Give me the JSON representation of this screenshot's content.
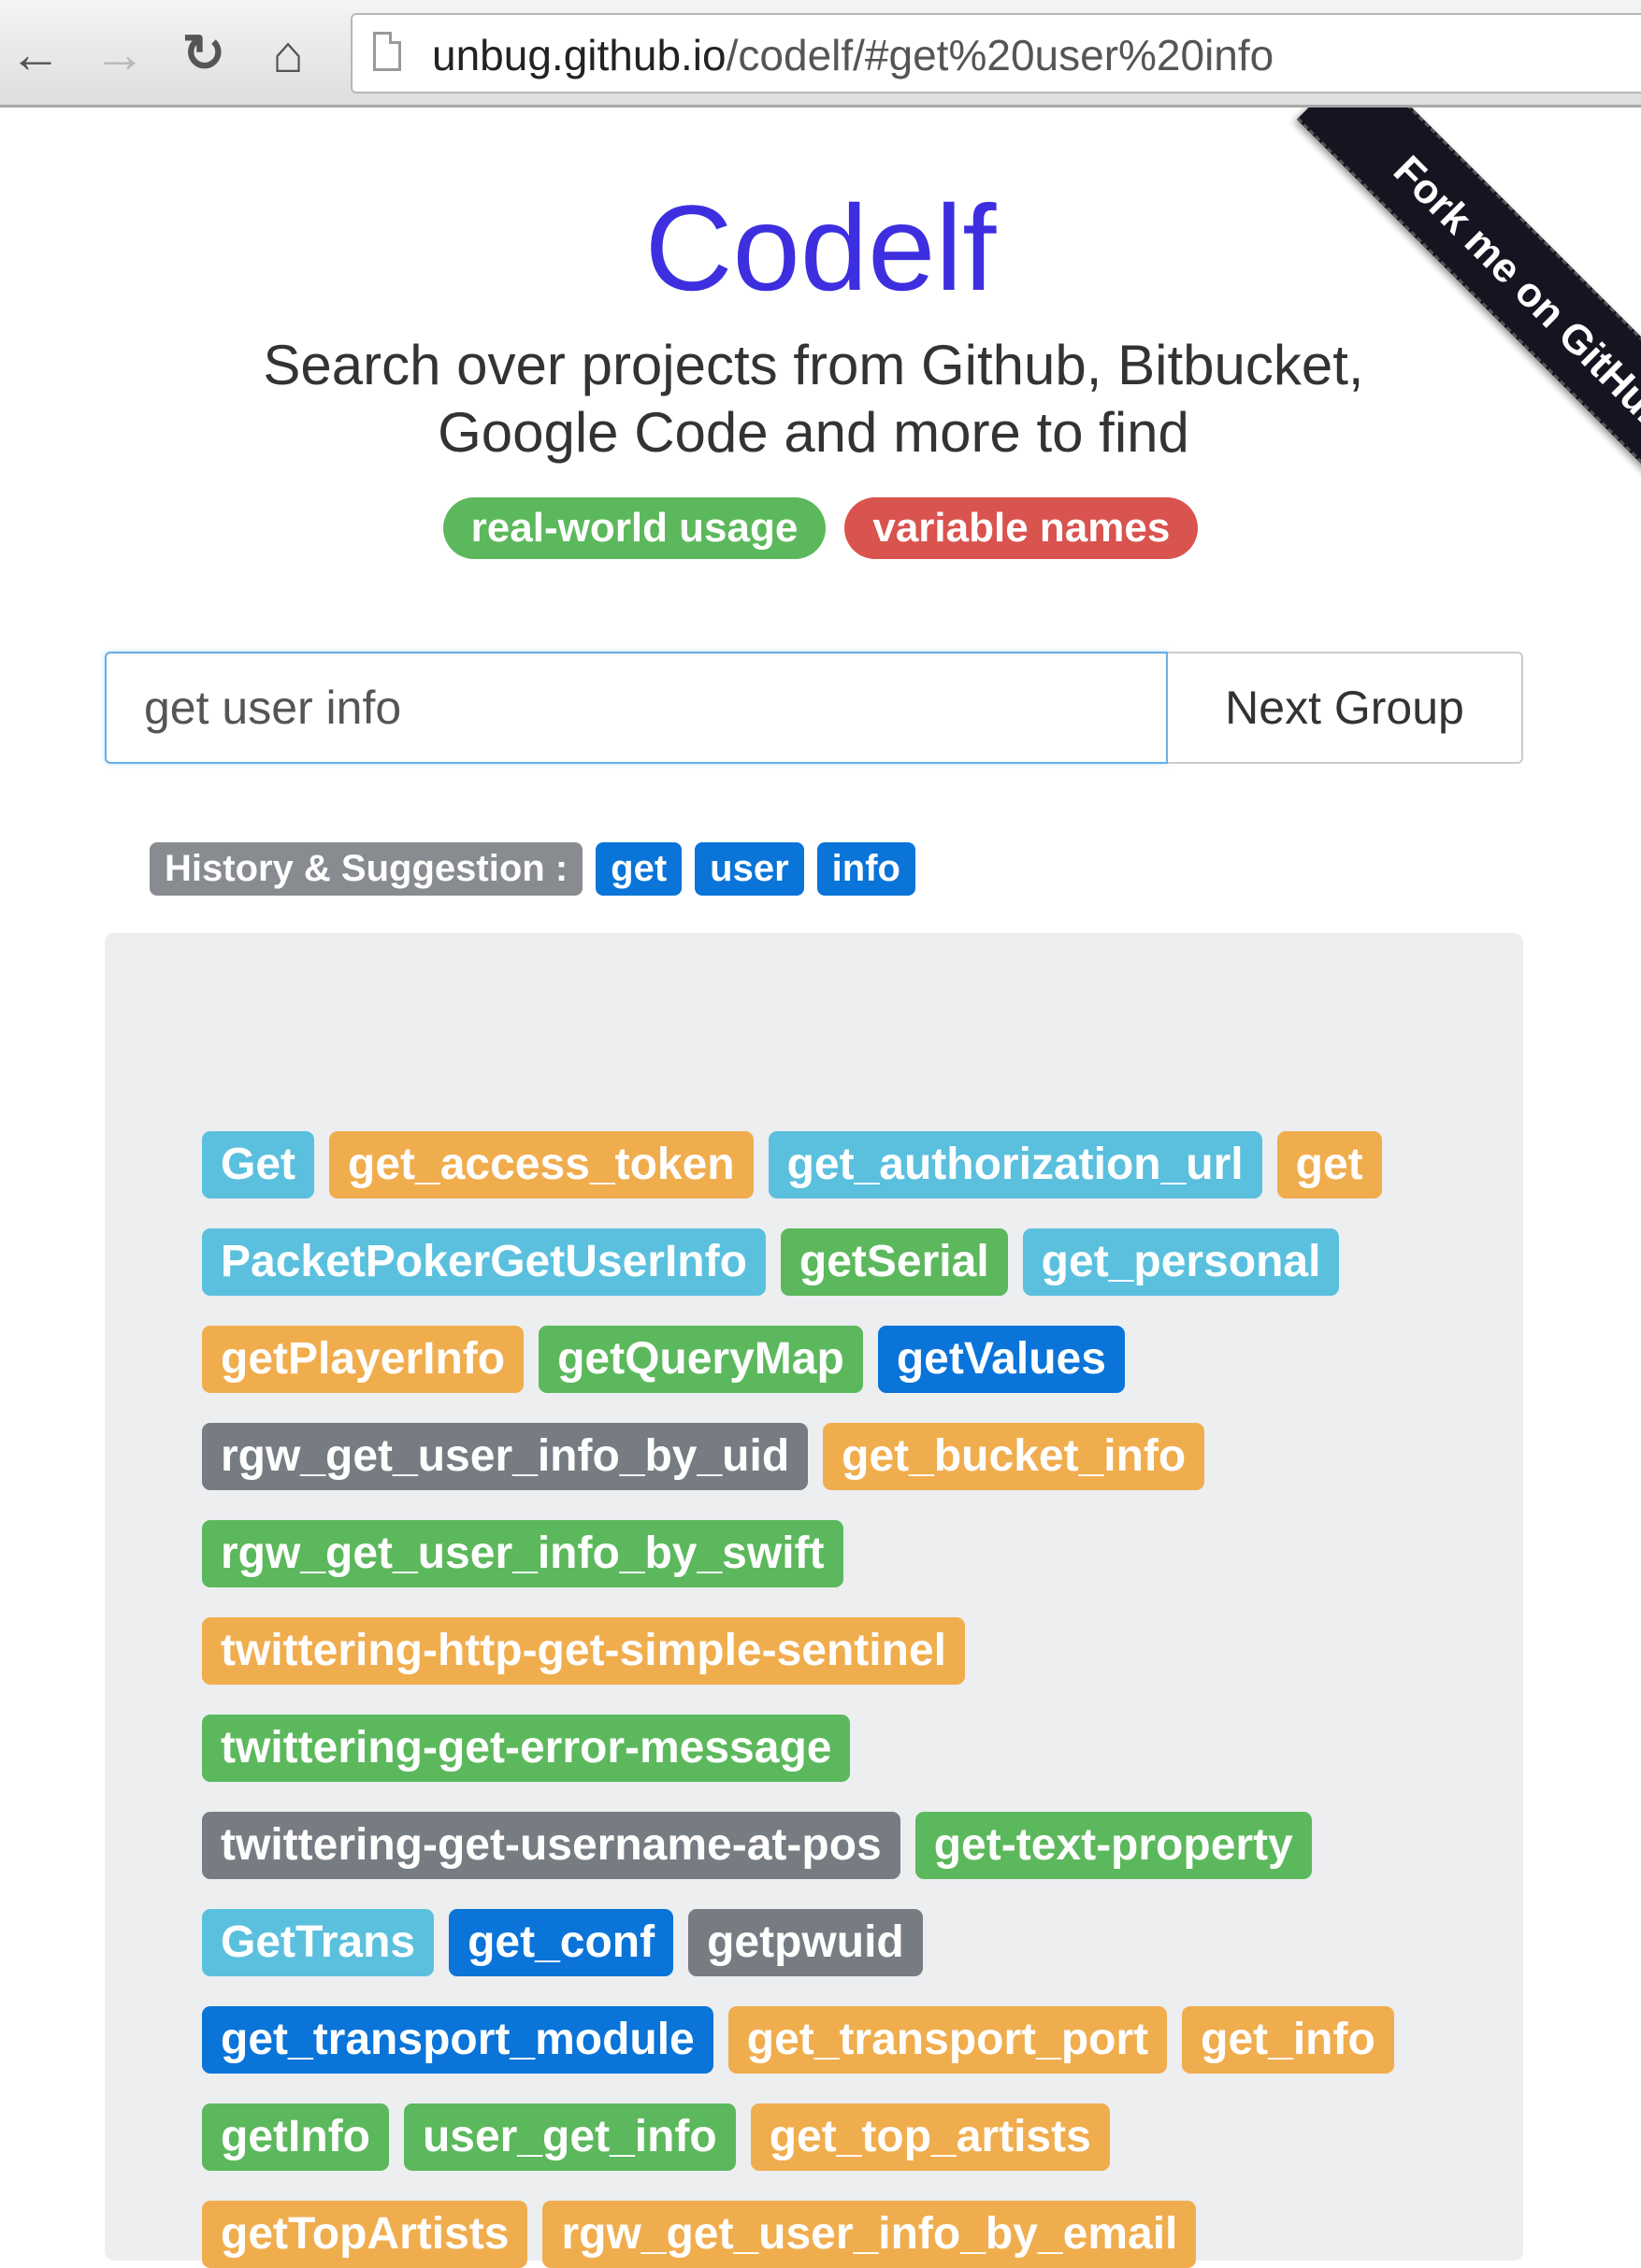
{
  "browser": {
    "back_icon": "←",
    "forward_icon": "→",
    "reload_icon": "↻",
    "home_icon": "⌂",
    "url_host": "unbug.github.io",
    "url_path": "/codelf/#get%20user%20info"
  },
  "ribbon": {
    "label": "Fork me on GitHub"
  },
  "header": {
    "title": "Codelf",
    "subtitle_line1": "Search over projects from Github, Bitbucket,",
    "subtitle_line2": "Google Code and more to find",
    "pills": [
      {
        "label": "real-world usage",
        "color": "#5cb85c"
      },
      {
        "label": "variable names",
        "color": "#d9534f"
      }
    ]
  },
  "search": {
    "value": "get user info",
    "button_label": "Next Group"
  },
  "history": {
    "label": "History & Suggestion :",
    "tags": [
      "get",
      "user",
      "info"
    ]
  },
  "colors": {
    "info": "#5bc0de",
    "warning": "#f0ad4e",
    "success": "#5cb85c",
    "primary": "#0a74d8",
    "default": "#777c83"
  },
  "results": [
    {
      "label": "Get",
      "color": "info"
    },
    {
      "label": "get_access_token",
      "color": "warning"
    },
    {
      "label": "get_authorization_url",
      "color": "info"
    },
    {
      "label": "get",
      "color": "warning"
    },
    {
      "label": "PacketPokerGetUserInfo",
      "color": "info"
    },
    {
      "label": "getSerial",
      "color": "success"
    },
    {
      "label": "get_personal",
      "color": "info"
    },
    {
      "label": "getPlayerInfo",
      "color": "warning"
    },
    {
      "label": "getQueryMap",
      "color": "success"
    },
    {
      "label": "getValues",
      "color": "primary"
    },
    {
      "label": "rgw_get_user_info_by_uid",
      "color": "default"
    },
    {
      "label": "get_bucket_info",
      "color": "warning"
    },
    {
      "label": "rgw_get_user_info_by_swift",
      "color": "success"
    },
    {
      "label": "twittering-http-get-simple-sentinel",
      "color": "warning"
    },
    {
      "label": "twittering-get-error-message",
      "color": "success"
    },
    {
      "label": "twittering-get-username-at-pos",
      "color": "default"
    },
    {
      "label": "get-text-property",
      "color": "success"
    },
    {
      "label": "GetTrans",
      "color": "info"
    },
    {
      "label": "get_conf",
      "color": "primary"
    },
    {
      "label": "getpwuid",
      "color": "default"
    },
    {
      "label": "get_transport_module",
      "color": "primary"
    },
    {
      "label": "get_transport_port",
      "color": "warning"
    },
    {
      "label": "get_info",
      "color": "warning"
    },
    {
      "label": "getInfo",
      "color": "success"
    },
    {
      "label": "user_get_info",
      "color": "success"
    },
    {
      "label": "get_top_artists",
      "color": "warning"
    },
    {
      "label": "getTopArtists",
      "color": "warning"
    },
    {
      "label": "rgw_get_user_info_by_email",
      "color": "warning"
    }
  ]
}
